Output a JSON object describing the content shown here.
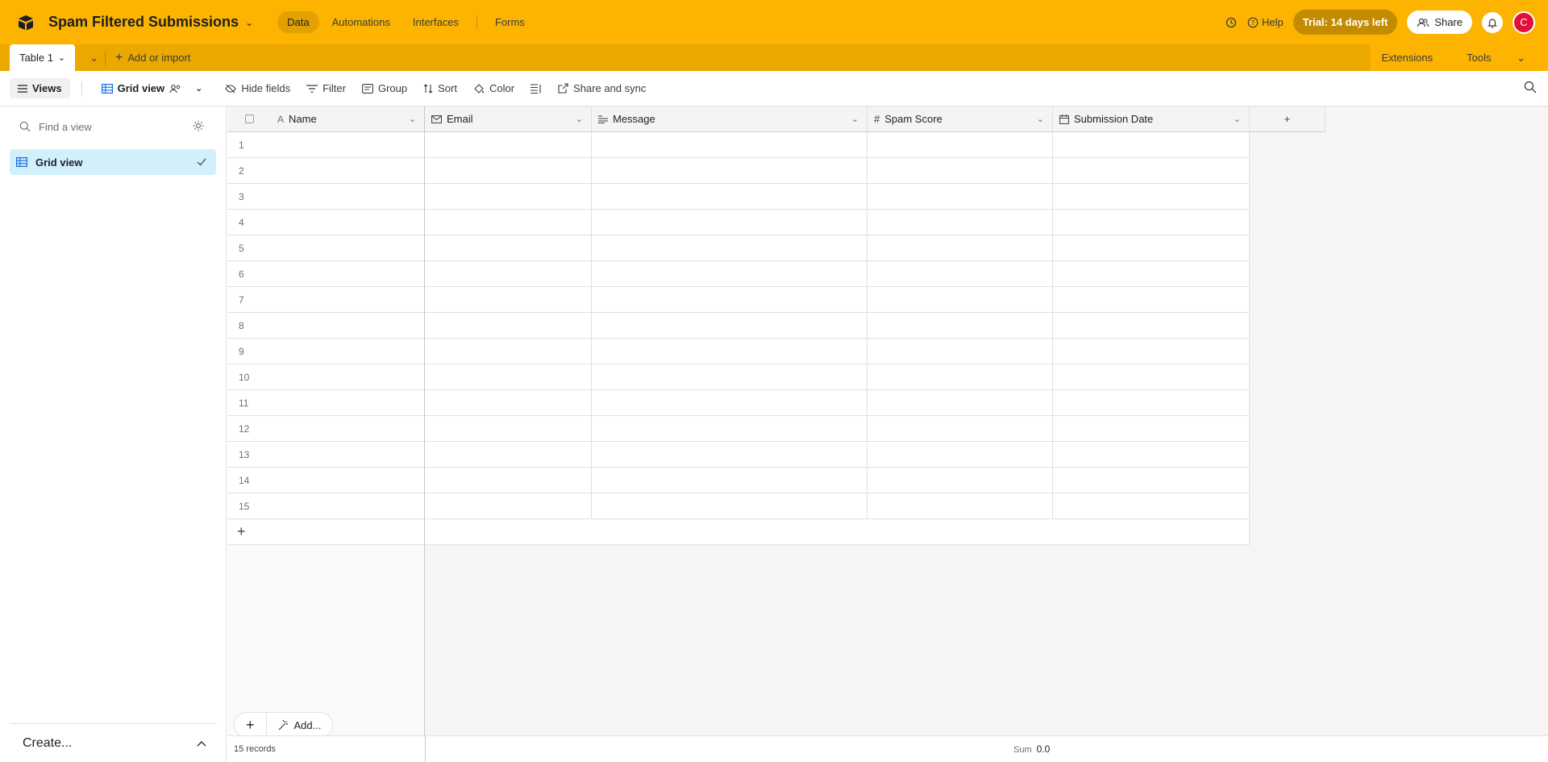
{
  "topbar": {
    "base_title": "Spam Filtered Submissions",
    "nav": [
      "Data",
      "Automations",
      "Interfaces",
      "Forms"
    ],
    "help": "Help",
    "trial": "Trial: 14 days left",
    "share": "Share",
    "avatar_initial": "C"
  },
  "tabbar": {
    "table_name": "Table 1",
    "add_import": "Add or import",
    "extensions": "Extensions",
    "tools": "Tools"
  },
  "viewbar": {
    "views": "Views",
    "grid_view": "Grid view",
    "hide_fields": "Hide fields",
    "filter": "Filter",
    "group": "Group",
    "sort": "Sort",
    "color": "Color",
    "share_sync": "Share and sync"
  },
  "sidebar": {
    "find_placeholder": "Find a view",
    "view_name": "Grid view",
    "create": "Create..."
  },
  "grid": {
    "columns": [
      "Name",
      "Email",
      "Message",
      "Spam Score",
      "Submission Date"
    ],
    "rows": [
      "1",
      "2",
      "3",
      "4",
      "5",
      "6",
      "7",
      "8",
      "9",
      "10",
      "11",
      "12",
      "13",
      "14",
      "15"
    ],
    "add_label": "Add...",
    "records": "15 records",
    "sum_label": "Sum",
    "sum_value": "0.0"
  },
  "colors": {
    "topbar": "#fcb400",
    "tabbar": "#eba900",
    "trial": "#c38c00",
    "avatar": "#e0103a",
    "selected_view": "#d1f0fc"
  }
}
